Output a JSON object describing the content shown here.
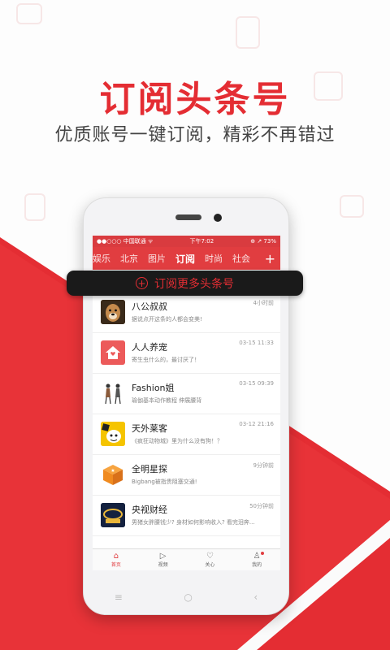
{
  "promo": {
    "title": "订阅头条号",
    "subtitle": "优质账号一键订阅，精彩不再错过",
    "banner_text": "订阅更多头条号"
  },
  "colors": {
    "brand_red": "#e42d33",
    "tab_bg": "#e13d40",
    "banner_bg": "#1a1a1a"
  },
  "status": {
    "carrier": "●●○○○ 中国联通 ᯤ",
    "time": "下午7:02",
    "battery": "⊕ ↗ 73%"
  },
  "tabs": [
    {
      "label": "娱乐"
    },
    {
      "label": "北京"
    },
    {
      "label": "图片"
    },
    {
      "label": "订阅"
    },
    {
      "label": "时尚"
    },
    {
      "label": "社会"
    }
  ],
  "tabs_plus": "+",
  "feed": [
    {
      "name": "八公叔叔",
      "desc": "据说点开这条的人都会变美!",
      "time": "4小时前",
      "avatar_icon": "dog-avatar-icon",
      "color": "#6b4a2c"
    },
    {
      "name": "人人养宠",
      "desc": "寄生虫什么的，最讨厌了！",
      "time": "03-15 11:33",
      "avatar_icon": "house-avatar-icon",
      "color": "#ec5a5a"
    },
    {
      "name": "Fashion姐",
      "desc": "瑜伽基本动作教程 伸展腰背",
      "time": "03-15 09:39",
      "avatar_icon": "fashion-avatar-icon",
      "color": "#ffffff"
    },
    {
      "name": "天外莱客",
      "desc": "《疯狂动物城》里为什么没有狗！？",
      "time": "03-12 21:16",
      "avatar_icon": "alien-avatar-icon",
      "color": "#f5c400"
    },
    {
      "name": "全明星探",
      "desc": "Bigbang被指贵阻塞交通!",
      "time": "9分钟前",
      "avatar_icon": "star-box-avatar-icon",
      "color": "#f08b20"
    },
    {
      "name": "央视财经",
      "desc": "男猪女胖腰钱少? 身材如何影响收入? 看完泪奔...",
      "time": "50分钟前",
      "avatar_icon": "cctv-avatar-icon",
      "color": "#1b2c54"
    }
  ],
  "bottom_nav": [
    {
      "label": "首页",
      "icon": "home-icon",
      "glyph": "⌂",
      "active": true
    },
    {
      "label": "视频",
      "icon": "play-icon",
      "glyph": "▷",
      "active": false
    },
    {
      "label": "关心",
      "icon": "heart-icon",
      "glyph": "♡",
      "active": false
    },
    {
      "label": "我的",
      "icon": "person-icon",
      "glyph": "♙",
      "active": false
    }
  ],
  "phone_keys": [
    "≡",
    "○",
    "‹"
  ]
}
